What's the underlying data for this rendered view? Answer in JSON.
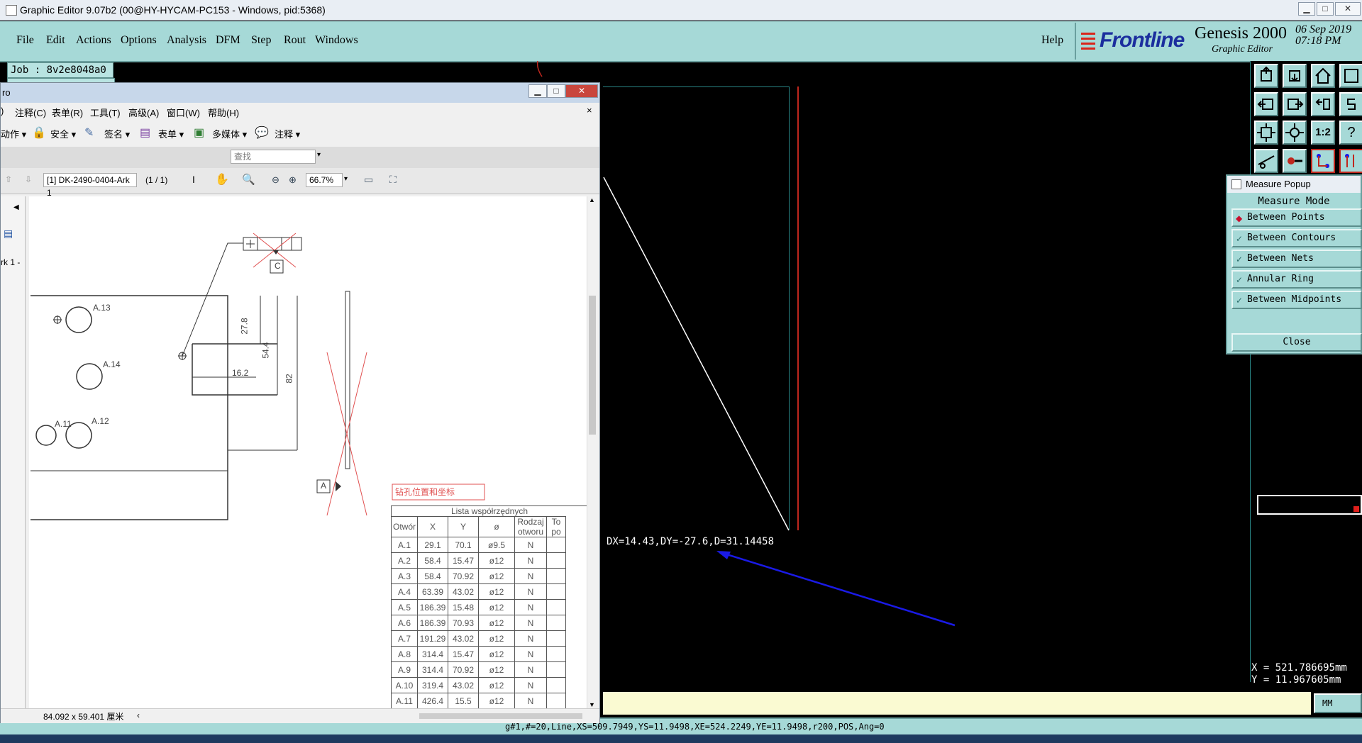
{
  "window": {
    "title": "Graphic Editor 9.07b2 (00@HY-HYCAM-PC153 - Windows, pid:5368)",
    "minimize": "▁",
    "maximize": "□",
    "close": "✕"
  },
  "menubar": {
    "items": [
      "File",
      "Edit",
      "Actions",
      "Options",
      "Analysis",
      "DFM",
      "Step",
      "Rout",
      "Windows"
    ],
    "help": "Help"
  },
  "branding": {
    "logo": "Frontline",
    "product": "Genesis 2000",
    "subtitle": "Graphic Editor",
    "date": "06 Sep 2019",
    "time": "07:18 PM"
  },
  "job": {
    "label": "Job : 8v2e8048a0"
  },
  "canvas": {
    "measure_readout": "DX=14.43,DY=-27.6,D=31.14458",
    "arrow_color": "#1a1ae6"
  },
  "measure_popup": {
    "title": "Measure Popup",
    "section": "Measure Mode",
    "modes": [
      {
        "label": "Between Points",
        "selected": true
      },
      {
        "label": "Between Contours",
        "selected": false
      },
      {
        "label": "Between Nets",
        "selected": false
      },
      {
        "label": "Annular Ring",
        "selected": false
      },
      {
        "label": "Between Midpoints",
        "selected": false
      }
    ],
    "close_label": "Close"
  },
  "coords": {
    "x": "X = 521.786695mm",
    "y": "Y = 11.967605mm"
  },
  "units": "MM",
  "status": "g#1,#=20,Line,XS=509.7949,YS=11.9498,XE=524.2249,YE=11.9498,r200,POS,Ang=0",
  "pdf": {
    "title": "ro",
    "menu": [
      "注释(C)",
      "表单(R)",
      "工具(T)",
      "高级(A)",
      "窗口(W)",
      "帮助(H)"
    ],
    "tools": [
      "动作",
      "安全",
      "签名",
      "表单",
      "多媒体",
      "注释"
    ],
    "search_placeholder": "查找",
    "page_field": "[1] DK-2490-0404-Ark 1",
    "page_count": "(1 / 1)",
    "zoom": "66.7%",
    "side_label": "rk 1 -",
    "page_size": "84.092 x 59.401 厘米",
    "drawing": {
      "holes": [
        "A.13",
        "A.14",
        "A.11",
        "A.12"
      ],
      "dims": [
        "27.8",
        "54.4",
        "82",
        "16.2"
      ],
      "datum_a": "A",
      "datum_c": "C",
      "callout_cn": "钻孔位置和坐标",
      "table_title": "Lista współrzędnych",
      "table_headers": [
        "Otwór",
        "X",
        "Y",
        "ø",
        "Rodzaj otworu",
        "To po"
      ],
      "rows": [
        [
          "A.1",
          "29.1",
          "70.1",
          "ø9.5",
          "N"
        ],
        [
          "A.2",
          "58.4",
          "15.47",
          "ø12",
          "N"
        ],
        [
          "A.3",
          "58.4",
          "70.92",
          "ø12",
          "N"
        ],
        [
          "A.4",
          "63.39",
          "43.02",
          "ø12",
          "N"
        ],
        [
          "A.5",
          "186.39",
          "15.48",
          "ø12",
          "N"
        ],
        [
          "A.6",
          "186.39",
          "70.93",
          "ø12",
          "N"
        ],
        [
          "A.7",
          "191.29",
          "43.02",
          "ø12",
          "N"
        ],
        [
          "A.8",
          "314.4",
          "15.47",
          "ø12",
          "N"
        ],
        [
          "A.9",
          "314.4",
          "70.92",
          "ø12",
          "N"
        ],
        [
          "A.10",
          "319.4",
          "43.02",
          "ø12",
          "N"
        ],
        [
          "A.11",
          "426.4",
          "15.5",
          "ø12",
          "N"
        ]
      ]
    }
  }
}
